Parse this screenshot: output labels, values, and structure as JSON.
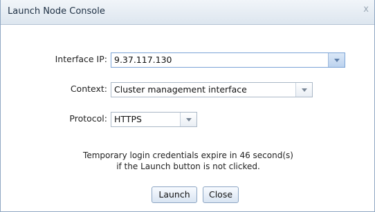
{
  "dialog": {
    "title": "Launch Node Console",
    "close_glyph": "x"
  },
  "fields": {
    "interface_ip": {
      "label": "Interface IP:",
      "value": "9.37.117.130"
    },
    "context": {
      "label": "Context:",
      "value": "Cluster management interface"
    },
    "protocol": {
      "label": "Protocol:",
      "value": "HTTPS"
    }
  },
  "message": {
    "line1": "Temporary login credentials expire in 46 second(s)",
    "line2": "if the Launch button is not clicked."
  },
  "buttons": {
    "launch": "Launch",
    "close": "Close"
  },
  "icons": {
    "close": "close-icon",
    "dropdown": "chevron-down-icon"
  }
}
